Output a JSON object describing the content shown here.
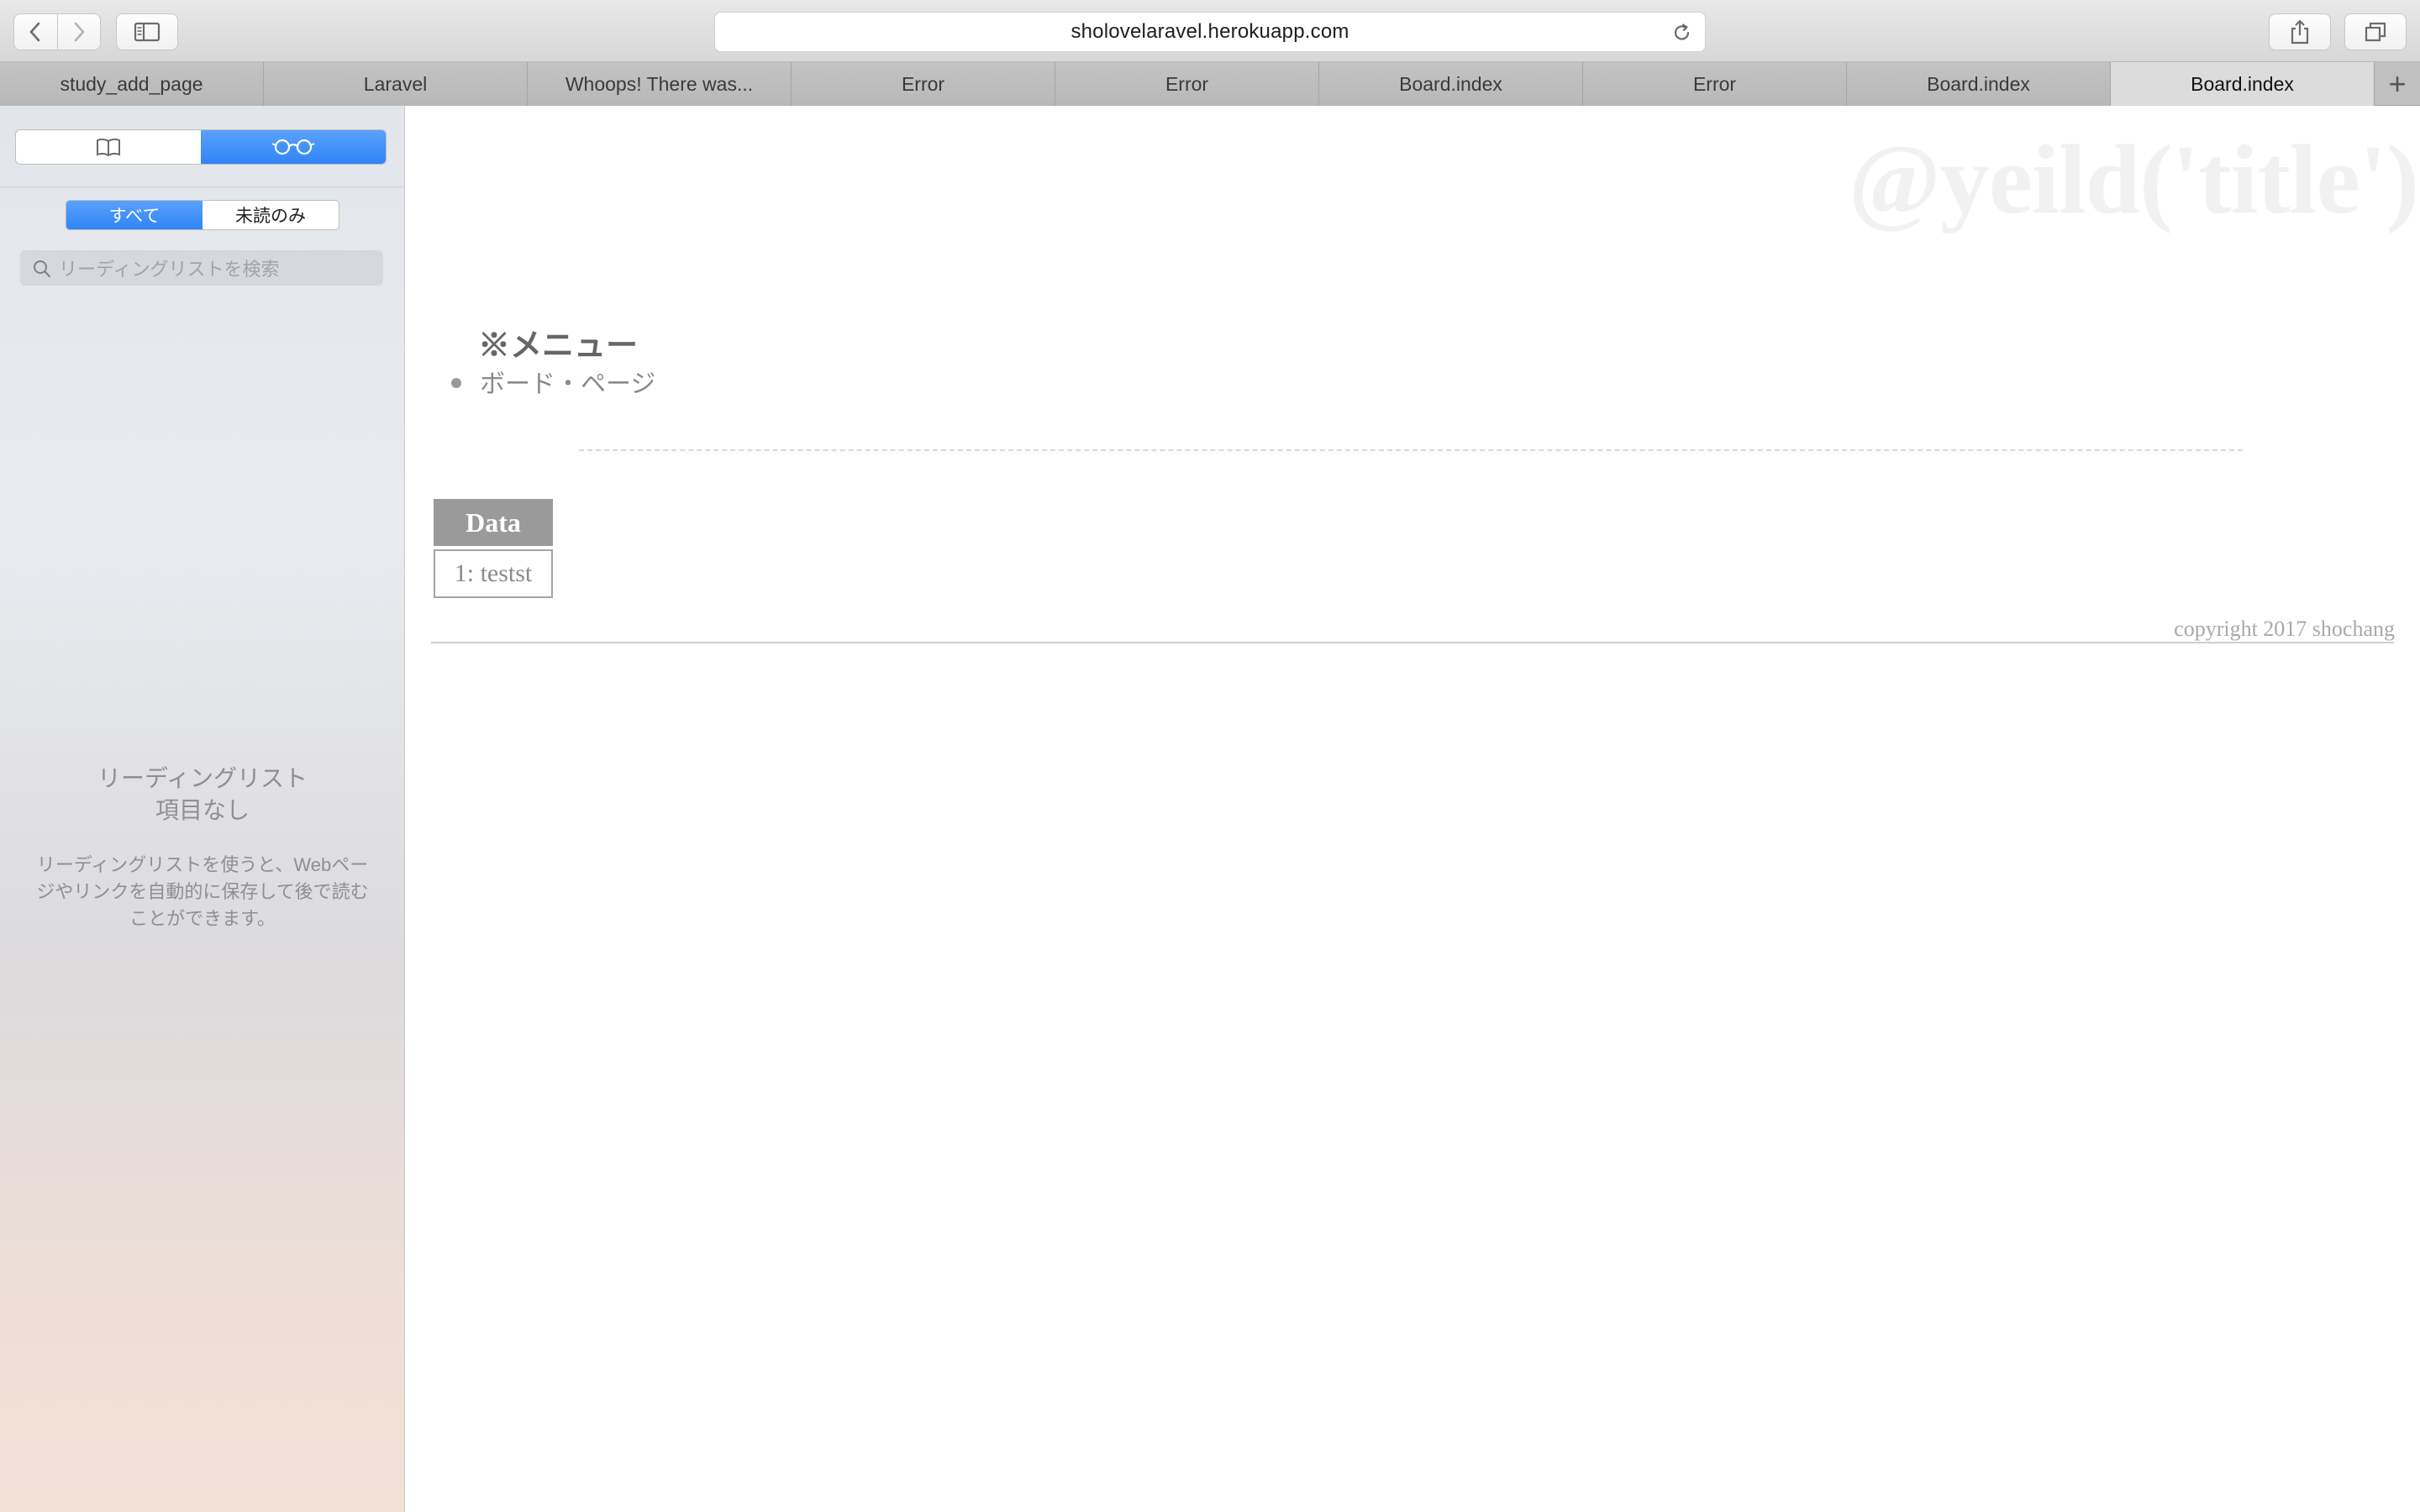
{
  "browser": {
    "url": "sholovelaravel.herokuapp.com",
    "tabs": [
      {
        "label": "study_add_page",
        "active": false
      },
      {
        "label": "Laravel",
        "active": false
      },
      {
        "label": "Whoops! There was...",
        "active": false
      },
      {
        "label": "Error",
        "active": false
      },
      {
        "label": "Error",
        "active": false
      },
      {
        "label": "Board.index",
        "active": false
      },
      {
        "label": "Error",
        "active": false
      },
      {
        "label": "Board.index",
        "active": false
      },
      {
        "label": "Board.index",
        "active": true
      }
    ],
    "new_tab_label": "+"
  },
  "sidebar": {
    "filter": {
      "all": "すべて",
      "unread": "未読のみ"
    },
    "search_placeholder": "リーディングリストを検索",
    "empty_title_line1": "リーディングリスト",
    "empty_title_line2": "項目なし",
    "empty_description": "リーディングリストを使うと、Webページやリンクを自動的に保存して後で読むことができます。"
  },
  "page": {
    "heading": "@yeild('title')",
    "menu_title": "※メニュー",
    "menu_items": [
      "ボード・ページ"
    ],
    "table": {
      "header": "Data",
      "rows": [
        "1: testst"
      ]
    },
    "copyright": "copyright 2017 shochang"
  },
  "colors": {
    "accent": "#3b8df8",
    "tab_active": "#dcdcdc",
    "table_header": "#9a9a9a"
  }
}
